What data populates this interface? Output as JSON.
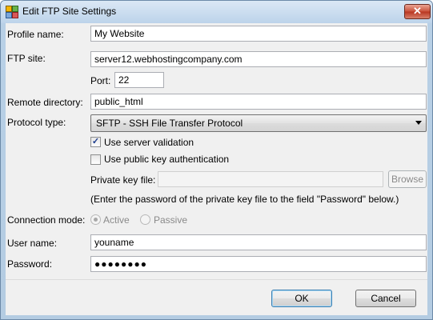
{
  "window": {
    "title": "Edit FTP Site Settings",
    "close_glyph": "✕",
    "icon": "app-grid-icon"
  },
  "form": {
    "profile_name_label": "Profile name:",
    "profile_name_value": "My Website",
    "ftp_site_label": "FTP site:",
    "ftp_site_value": "server12.webhostingcompany.com",
    "port_label": "Port:",
    "port_value": "22",
    "remote_directory_label": "Remote directory:",
    "remote_directory_value": "public_html",
    "protocol_type_label": "Protocol type:",
    "protocol_type_value": "SFTP - SSH File Transfer Protocol",
    "use_server_validation_label": "Use server validation",
    "use_server_validation_checked": true,
    "use_public_key_label": "Use public key authentication",
    "use_public_key_checked": false,
    "private_key_file_label": "Private key file:",
    "private_key_file_value": "",
    "browse_label": "Browse",
    "private_key_note": "(Enter the password of the private key file to the field \"Password\" below.)",
    "connection_mode_label": "Connection mode:",
    "active_label": "Active",
    "passive_label": "Passive",
    "connection_mode_selected": "Active",
    "user_name_label": "User name:",
    "user_name_value": "youname",
    "password_label": "Password:",
    "password_value": "●●●●●●●●"
  },
  "footer": {
    "ok_label": "OK",
    "cancel_label": "Cancel"
  },
  "colors": {
    "checkmark": "#1c3c8c",
    "default_button_border": "#3c7fb1"
  }
}
